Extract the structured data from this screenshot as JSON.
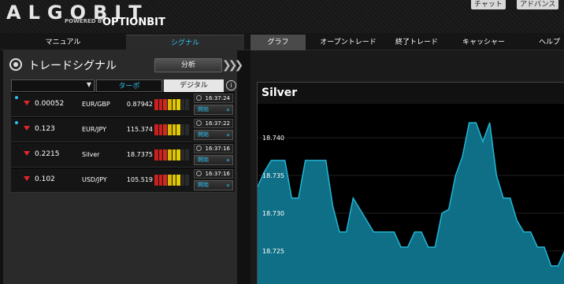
{
  "header": {
    "logo_text": "ALGOBIT",
    "logo_powered": "POWERED BY",
    "logo_brand": "OPTIONBIT",
    "chat_label": "チャット",
    "advice_label": "アドバンス"
  },
  "nav": {
    "tabs": [
      {
        "label": "マニュアル"
      },
      {
        "label": "シグナル"
      },
      {
        "label": "グラフ"
      },
      {
        "label": "オープントレード"
      },
      {
        "label": "終了トレード"
      },
      {
        "label": "キャッシャー"
      },
      {
        "label": "ヘルプ"
      }
    ]
  },
  "signals_panel": {
    "title": "トレードシグナル",
    "analyze_label": "分析",
    "filter_select_value": "",
    "turbo_label": "ターボ",
    "digital_label": "デジタル",
    "info_label": "i",
    "rows": [
      {
        "value": "0.00052",
        "asset": "EUR/GBP",
        "price": "0.87942",
        "time": "16:37:24",
        "start": "開始",
        "dot_color": "#2ec0f0"
      },
      {
        "value": "0.123",
        "asset": "EUR/JPY",
        "price": "115.374",
        "time": "16:37:22",
        "start": "開始",
        "dot_color": "#2ec0f0"
      },
      {
        "value": "0.2215",
        "asset": "Silver",
        "price": "18.7375",
        "time": "16:37:16",
        "start": "開始",
        "dot_color": "#111111"
      },
      {
        "value": "0.102",
        "asset": "USD/JPY",
        "price": "105.519",
        "time": "16:37:16",
        "start": "開始",
        "dot_color": "#111111"
      }
    ],
    "direction_icon": "down-triangle-icon",
    "bar_colors": [
      "#c8201f",
      "#c8201f",
      "#d02a1f",
      "#d8b800",
      "#e0c400",
      "#e6cf00",
      "#2a2a2a",
      "#2a2a2a"
    ]
  },
  "chart_data": {
    "type": "area",
    "title": "Silver",
    "ylim": [
      18.7205,
      18.7445
    ],
    "yticks": [
      "18.740",
      "18.735",
      "18.730",
      "18.725"
    ],
    "ytick_values": [
      18.74,
      18.735,
      18.73,
      18.725
    ],
    "color": "#22b5d4",
    "fill": "#0f6f86",
    "values": [
      18.7335,
      18.7355,
      18.737,
      18.737,
      18.737,
      18.732,
      18.732,
      18.737,
      18.737,
      18.737,
      18.737,
      18.731,
      18.7275,
      18.7275,
      18.732,
      18.7305,
      18.729,
      18.7275,
      18.7275,
      18.7275,
      18.7275,
      18.7255,
      18.7255,
      18.7275,
      18.7275,
      18.7255,
      18.7255,
      18.73,
      18.7305,
      18.735,
      18.7375,
      18.742,
      18.742,
      18.7395,
      18.742,
      18.735,
      18.732,
      18.732,
      18.729,
      18.7275,
      18.7275,
      18.7255,
      18.7255,
      18.723,
      18.723,
      18.725
    ]
  }
}
